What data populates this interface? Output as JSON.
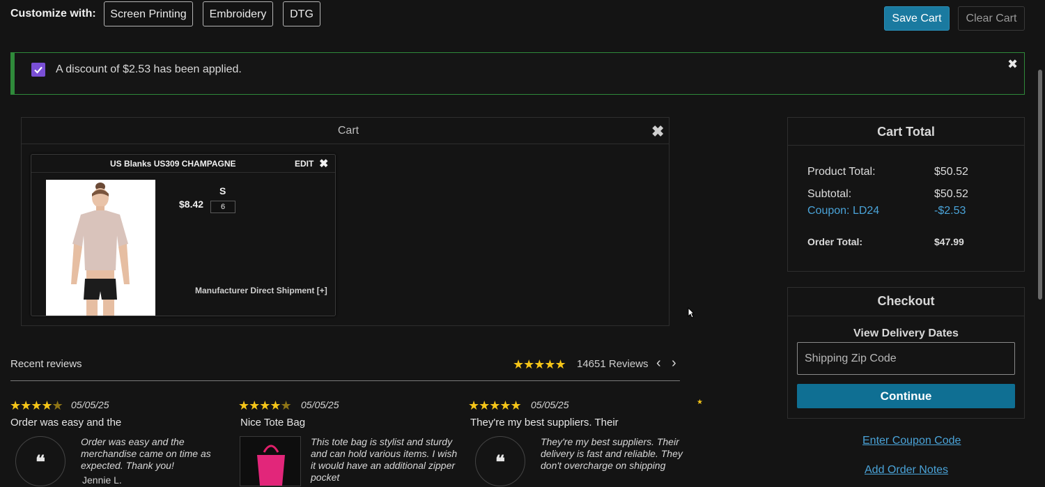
{
  "topbar": {
    "customize_label": "Customize with:",
    "methods": [
      "Screen Printing",
      "Embroidery",
      "DTG"
    ],
    "save_cart": "Save Cart",
    "clear_cart": "Clear Cart"
  },
  "alert": {
    "message": "A discount of $2.53 has been applied.",
    "close_icon": "✖",
    "checkbox_color": "#7a4fd6",
    "border_color": "#2f8a3a"
  },
  "cart": {
    "title": "Cart",
    "close_icon": "✖",
    "item": {
      "name": "US Blanks US309 CHAMPAGNE",
      "edit_label": "EDIT",
      "remove_icon": "✖",
      "price": "$8.42",
      "size": "S",
      "quantity": "6",
      "shipment": "Manufacturer Direct Shipment [+]"
    }
  },
  "cart_total": {
    "title": "Cart Total",
    "product_total_label": "Product Total:",
    "product_total_value": "$50.52",
    "subtotal_label": "Subtotal:",
    "subtotal_value": "$50.52",
    "coupon_label": "Coupon: LD24",
    "coupon_value": "-$2.53",
    "order_total_label": "Order Total:",
    "order_total_value": "$47.99"
  },
  "checkout": {
    "title": "Checkout",
    "delivery_label": "View Delivery Dates",
    "zip_placeholder": "Shipping Zip Code",
    "continue_label": "Continue",
    "coupon_link": "Enter Coupon Code",
    "notes_link": "Add Order Notes"
  },
  "reviews": {
    "label": "Recent reviews",
    "count_text": "14651 Reviews",
    "overall_rating": 5,
    "items": [
      {
        "rating": 4.5,
        "date": "05/05/25",
        "title": "Order was easy and the",
        "body": "Order was easy and the merchandise came on time as expected. Thank you!",
        "author": "Jennie L."
      },
      {
        "rating": 4.5,
        "date": "05/05/25",
        "title": "Nice Tote Bag",
        "body": "This tote bag is stylist and sturdy and can hold various items. I wish it would have an additional zipper pocket"
      },
      {
        "rating": 5,
        "date": "05/05/25",
        "title": "They're my best suppliers. Their",
        "body": "They're my best suppliers. Their delivery is fast and reliable. They don't overcharge on shipping"
      }
    ]
  }
}
